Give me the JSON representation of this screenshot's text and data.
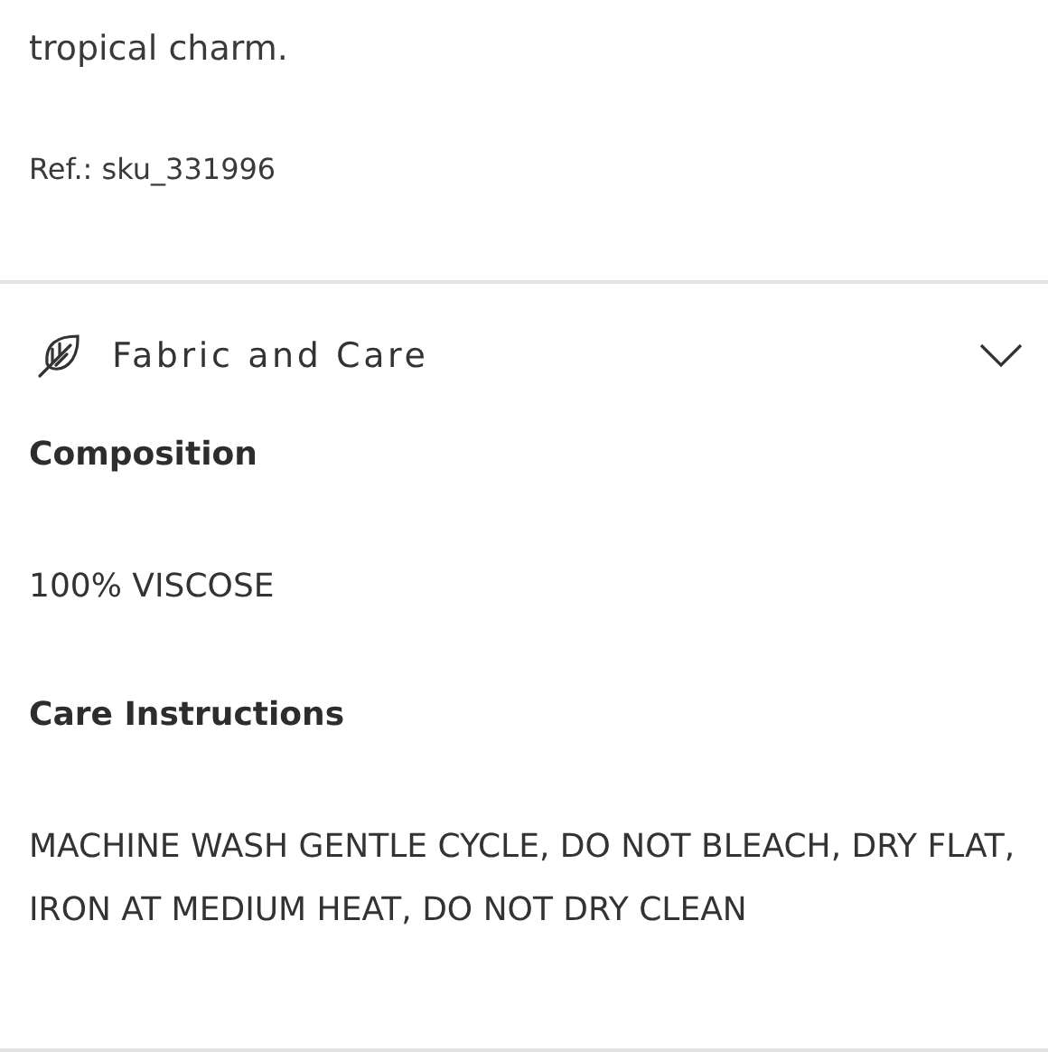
{
  "description": {
    "text_tail": "tropical charm.",
    "reference": "Ref.: sku_331996"
  },
  "accordion": {
    "title": "Fabric and Care",
    "expanded": true,
    "sections": [
      {
        "heading": "Composition",
        "body": "100% VISCOSE"
      },
      {
        "heading": "Care Instructions",
        "body": "MACHINE WASH GENTLE CYCLE, DO NOT BLEACH, DRY FLAT, IRON AT MEDIUM HEAT, DO NOT DRY CLEAN"
      }
    ]
  }
}
